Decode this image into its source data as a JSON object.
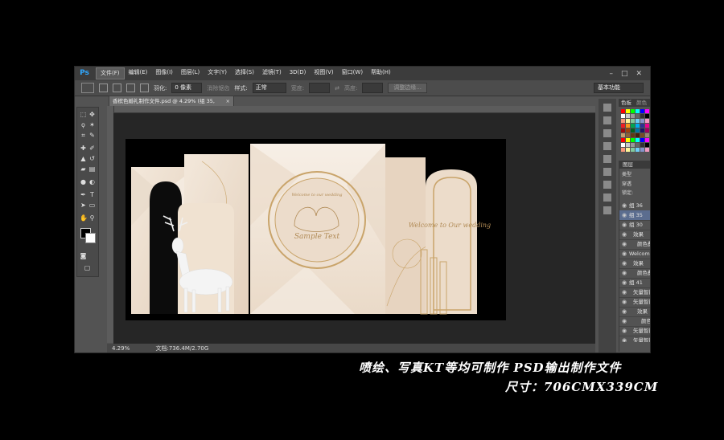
{
  "app": {
    "logo": "Ps",
    "menu": [
      "文件(F)",
      "编辑(E)",
      "图像(I)",
      "图层(L)",
      "文字(Y)",
      "选择(S)",
      "滤镜(T)",
      "3D(D)",
      "视图(V)",
      "窗口(W)",
      "帮助(H)"
    ],
    "window_controls": [
      "–",
      "□",
      "✕"
    ]
  },
  "options": {
    "feather_label": "羽化:",
    "feather_value": "0 像素",
    "antialias_label": "消除锯齿",
    "style_label": "样式:",
    "style_value": "正常",
    "width_label": "宽度:",
    "height_label": "高度:",
    "refine_button": "调整边缘...",
    "workspace": "基本功能"
  },
  "document": {
    "tab_title": "香槟色婚礼制作文件.psd @ 4.29% (组 35, CMYK/8)",
    "zoom": "4.29%",
    "doc_info": "文档:736.4M/2.70G"
  },
  "design": {
    "circle_script_top": "Welcome to our wedding",
    "circle_text": "Sample Text",
    "arch_text": "Welcome to Our wedding"
  },
  "panels": {
    "swatches_tabs": [
      "色板",
      "颜色"
    ],
    "layers_tab": "图层",
    "filter_kind": "类型",
    "blend_mode": "穿透",
    "opacity_label": "不透明度:",
    "opacity_value": "100%",
    "lock_label": "锁定:",
    "fill_label": "填充:",
    "fill_value": "100%",
    "layers": [
      {
        "name": "组 36",
        "type": "group",
        "indent": 0,
        "selected": false
      },
      {
        "name": "组 35",
        "type": "group",
        "indent": 0,
        "selected": true
      },
      {
        "name": "组 30",
        "type": "group",
        "indent": 0,
        "selected": false,
        "fx": "fx"
      },
      {
        "name": "效果",
        "type": "effect",
        "indent": 1,
        "selected": false
      },
      {
        "name": "颜色叠加",
        "type": "effect",
        "indent": 2,
        "selected": false
      },
      {
        "name": "Welcome to",
        "type": "text",
        "indent": 0,
        "selected": false,
        "fx": "fx"
      },
      {
        "name": "效果",
        "type": "effect",
        "indent": 1,
        "selected": false
      },
      {
        "name": "颜色叠加",
        "type": "effect",
        "indent": 2,
        "selected": false
      },
      {
        "name": "组 41",
        "type": "group",
        "indent": 0,
        "selected": false
      },
      {
        "name": "矢量智能对象 4",
        "type": "smart",
        "indent": 1,
        "selected": false
      },
      {
        "name": "矢量智能对象 4...",
        "type": "smart",
        "indent": 1,
        "selected": false,
        "fx": "fx"
      },
      {
        "name": "效果",
        "type": "effect",
        "indent": 2,
        "selected": false
      },
      {
        "name": "颜色叠加",
        "type": "effect",
        "indent": 3,
        "selected": false
      },
      {
        "name": "矢量智能对象 4 拷贝",
        "type": "smart",
        "indent": 1,
        "selected": false
      },
      {
        "name": "矢量智能对象 4...",
        "type": "smart",
        "indent": 1,
        "selected": false
      }
    ]
  },
  "caption": {
    "line1": "喷绘、写真KT等均可制作   PSD输出制作文件",
    "line2": "尺寸：706CMX339CM"
  },
  "colors": {
    "bg": "#000000",
    "app_bg": "#535353",
    "selected_layer": "#5b6d8f",
    "champagne": "#efe1cf",
    "gold": "#c9a46a"
  }
}
